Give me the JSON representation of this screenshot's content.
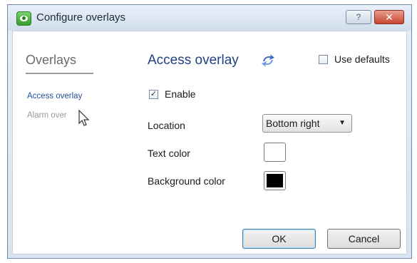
{
  "window": {
    "title": "Configure overlays",
    "help_label": "?",
    "close_label": "✕",
    "icon": "eye-app-icon"
  },
  "sidebar": {
    "heading": "Overlays",
    "items": [
      {
        "label": "Access overlay",
        "selected": true
      },
      {
        "label": "Alarm over",
        "selected": false
      }
    ]
  },
  "main": {
    "heading": "Access overlay",
    "heading_icon": "refresh-arrows-icon",
    "use_defaults": {
      "label": "Use defaults",
      "checked": false
    },
    "enable": {
      "label": "Enable",
      "checked": true,
      "mark": "✓"
    },
    "location": {
      "label": "Location",
      "value": "Bottom right",
      "arrow": "▼"
    },
    "text_color": {
      "label": "Text color",
      "value": "#ffffff"
    },
    "background_color": {
      "label": "Background color",
      "value": "#000000"
    }
  },
  "buttons": {
    "ok": "OK",
    "cancel": "Cancel"
  },
  "colors": {
    "heading": "#1f3f86",
    "sidebar_selected": "#1f4e96",
    "sidebar_inactive": "#9a9a9a"
  }
}
